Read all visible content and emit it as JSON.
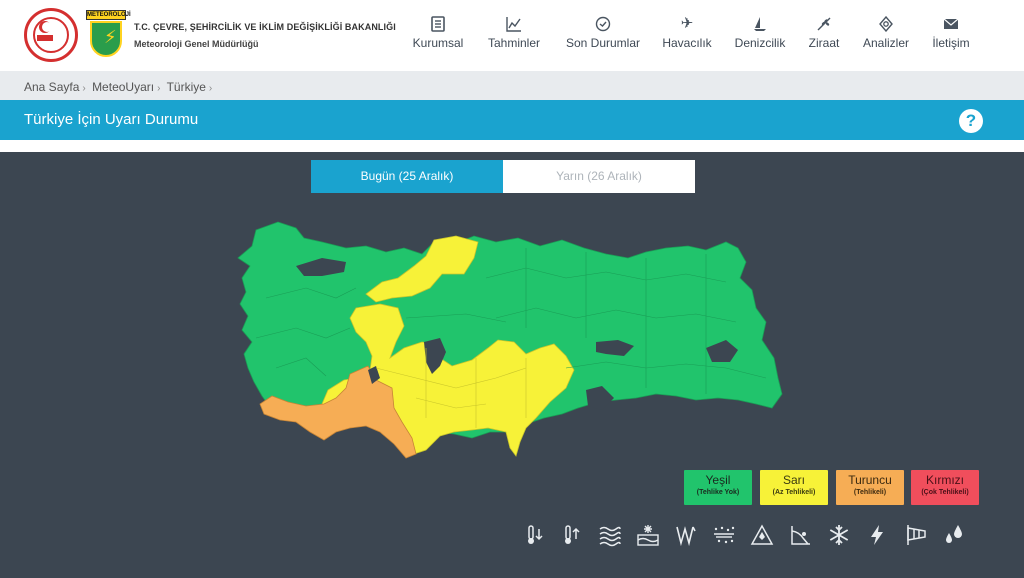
{
  "header": {
    "ministry_name": "T.C. ÇEVRE, ŞEHİRCİLİK VE İKLİM DEĞİŞİKLİĞİ BAKANLIĞI",
    "ministry_sub": "Meteoroloji Genel Müdürlüğü",
    "mgm_logo_text": "METEOROLOJİ"
  },
  "nav": [
    {
      "label": "Kurumsal",
      "icon": "document-icon"
    },
    {
      "label": "Tahminler",
      "icon": "chart-line-icon"
    },
    {
      "label": "Son Durumlar",
      "icon": "clock-check-icon"
    },
    {
      "label": "Havacılık",
      "icon": "airplane-icon"
    },
    {
      "label": "Denizcilik",
      "icon": "sailboat-icon"
    },
    {
      "label": "Ziraat",
      "icon": "wheat-icon"
    },
    {
      "label": "Analizler",
      "icon": "analysis-icon"
    },
    {
      "label": "İletişim",
      "icon": "envelope-icon"
    }
  ],
  "breadcrumb": [
    "Ana Sayfa",
    "MeteoUyarı",
    "Türkiye"
  ],
  "title": "Türkiye İçin Uyarı Durumu",
  "help": "?",
  "tabs": {
    "today": "Bugün (25 Aralık)",
    "tomorrow": "Yarın (26 Aralık)"
  },
  "legend": [
    {
      "name": "Yeşil",
      "desc": "(Tehlike Yok)",
      "color": "#21c46c"
    },
    {
      "name": "Sarı",
      "desc": "(Az Tehlikeli)",
      "color": "#f7f238"
    },
    {
      "name": "Turuncu",
      "desc": "(Tehlikeli)",
      "color": "#f6ad55"
    },
    {
      "name": "Kırmızı",
      "desc": "(Çok Tehlikeli)",
      "color": "#f04e5c"
    }
  ],
  "phenomena": [
    "cold-thermometer-icon",
    "hot-thermometer-icon",
    "fog-icon",
    "snow-melt-icon",
    "wind-storm-icon",
    "dust-icon",
    "avalanche-icon",
    "landslide-icon",
    "snowflake-icon",
    "lightning-icon",
    "windsock-icon",
    "rain-drops-icon"
  ],
  "colors": {
    "accent": "#1aa3cf",
    "map_green": "#21c46c",
    "map_yellow": "#f7f238",
    "map_orange": "#f6ad55",
    "background": "#3c4651"
  }
}
